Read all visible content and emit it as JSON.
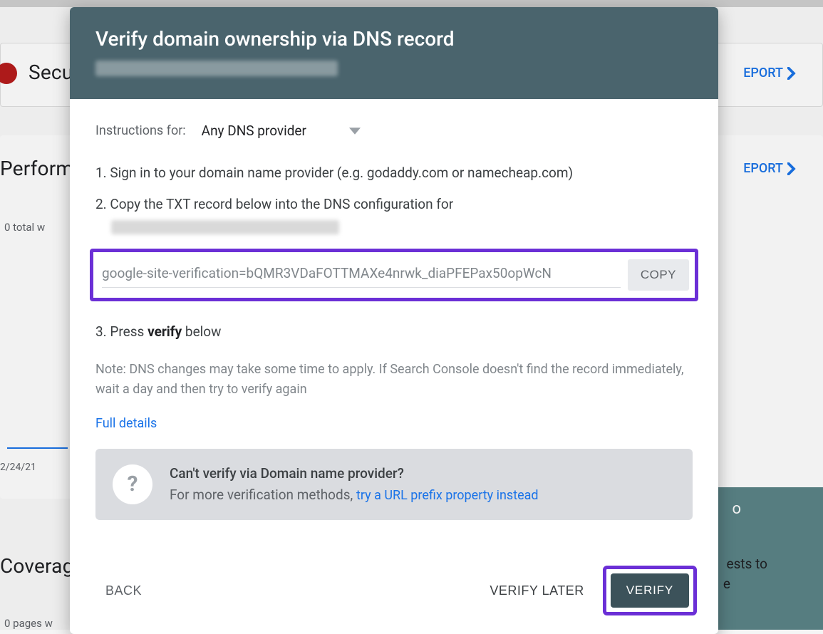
{
  "background": {
    "security_label": "Secur",
    "performance_label": "Perform",
    "coverage_label": "Coverag",
    "report_link": "EPORT",
    "total_text": "0 total w",
    "date_text": "2/24/21",
    "pages_text": "0 pages w",
    "sts_fragment": "ests to",
    "e_fragment": "e",
    "o_fragment": "o"
  },
  "dialog": {
    "title": "Verify domain ownership via DNS record",
    "instructions_label": "Instructions for:",
    "provider_selected": "Any DNS provider",
    "step1": "1. Sign in to your domain name provider (e.g. godaddy.com or namecheap.com)",
    "step2": "2. Copy the TXT record below into the DNS configuration for",
    "txt_value": "google-site-verification=bQMR3VDaFOTTMAXe4nrwk_diaPFEPax50opWcN",
    "copy_label": "COPY",
    "step3_pre": "3. Press ",
    "step3_bold": "verify",
    "step3_post": " below",
    "note": "Note: DNS changes may take some time to apply. If Search Console doesn't find the record immediately, wait a day and then try to verify again",
    "full_details": "Full details",
    "alt_title": "Can't verify via Domain name provider?",
    "alt_sub_pre": "For more verification methods, ",
    "alt_link": "try a URL prefix property instead",
    "back": "BACK",
    "verify_later": "VERIFY LATER",
    "verify": "VERIFY"
  }
}
